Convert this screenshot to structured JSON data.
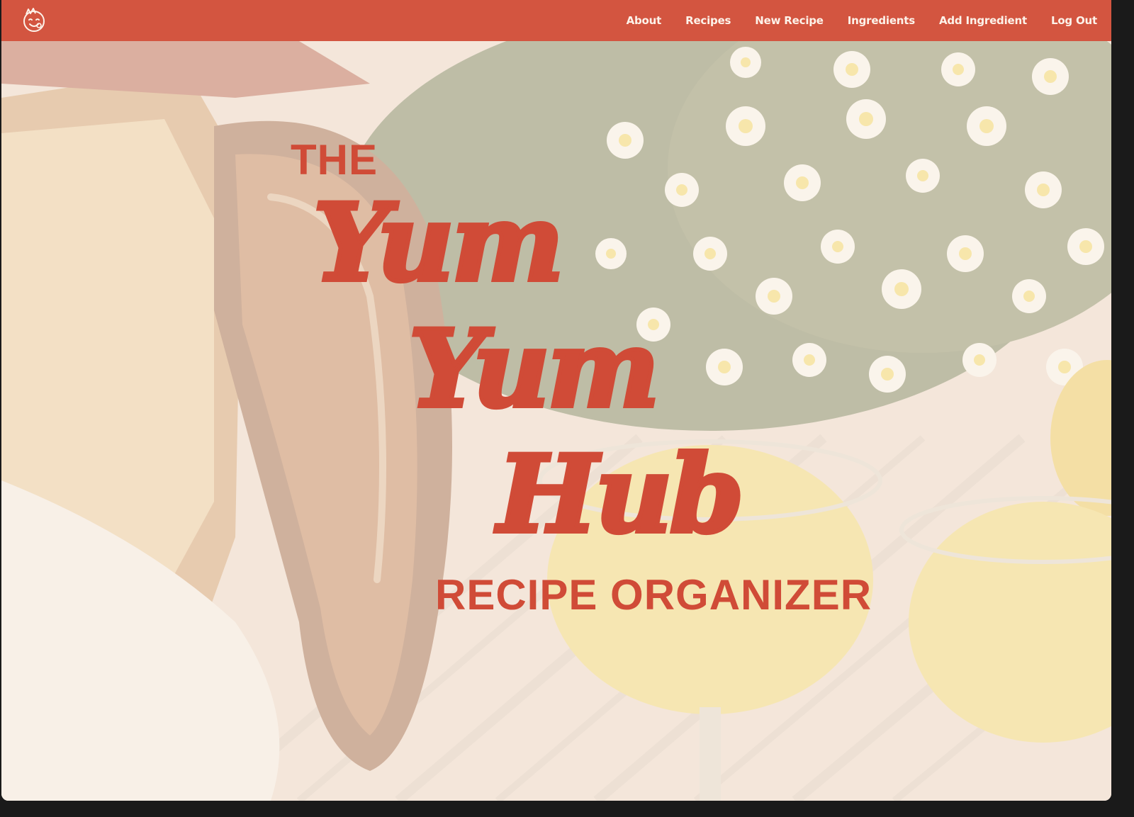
{
  "navbar": {
    "logo_icon": "smiling-face-logo-icon",
    "links": [
      {
        "label": "About"
      },
      {
        "label": "Recipes"
      },
      {
        "label": "New Recipe"
      },
      {
        "label": "Ingredients"
      },
      {
        "label": "Add Ingredient"
      },
      {
        "label": "Log Out"
      }
    ]
  },
  "hero": {
    "the_label": "THE",
    "script_lines": [
      "Yum",
      "Yum",
      "Hub"
    ],
    "subtitle": "RECIPE ORGANIZER",
    "background_image": "bread-and-daisies-photo"
  },
  "colors": {
    "brand": "#d35540",
    "title": "#d04b37",
    "nav_text": "#fdf3ea"
  }
}
